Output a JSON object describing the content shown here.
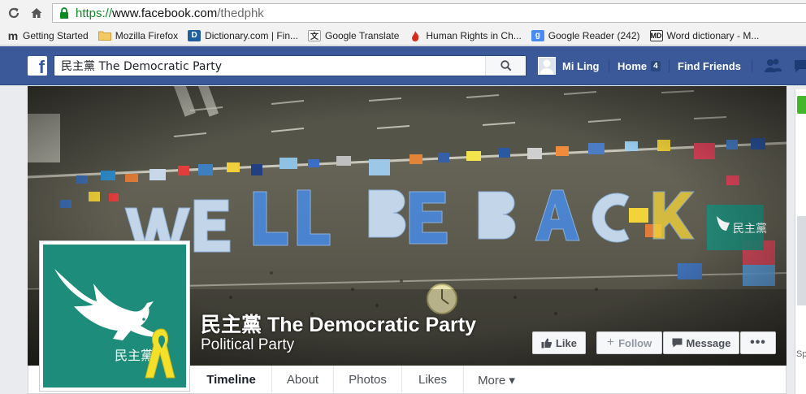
{
  "browser": {
    "url_secure": "https://",
    "url_host": "www.facebook.com",
    "url_path": "/thedphk",
    "bookmarks": [
      {
        "label": "Getting Started",
        "icon": "m-logo-icon"
      },
      {
        "label": "Mozilla Firefox",
        "icon": "folder-icon"
      },
      {
        "label": "Dictionary.com | Fin...",
        "icon": "dictionary-icon"
      },
      {
        "label": "Google Translate",
        "icon": "translate-icon"
      },
      {
        "label": "Human Rights in Ch...",
        "icon": "flame-icon"
      },
      {
        "label": "Google Reader (242)",
        "icon": "google-reader-icon"
      },
      {
        "label": "Word dictionary - M...",
        "icon": "md-icon"
      }
    ]
  },
  "fbbar": {
    "logo": "f",
    "search_value": "民主黨 The Democratic Party",
    "user_name": "Mi Ling",
    "home_label": "Home",
    "home_count": "4",
    "find_friends": "Find Friends"
  },
  "page": {
    "name": "民主黨 The Democratic Party",
    "category": "Political Party",
    "cover_text": "WE'LL BE BACK",
    "cover_badge": "民主黨"
  },
  "actions": {
    "like": "Like",
    "follow": "Follow",
    "message": "Message",
    "more": "•••"
  },
  "tabs": {
    "timeline": "Timeline",
    "about": "About",
    "photos": "Photos",
    "likes": "Likes",
    "more": "More ▾"
  },
  "right": {
    "sp": "Sp"
  },
  "colors": {
    "fb_blue": "#3b5998",
    "party_green": "#1d8c7a",
    "ribbon_yellow": "#f2e02b"
  }
}
